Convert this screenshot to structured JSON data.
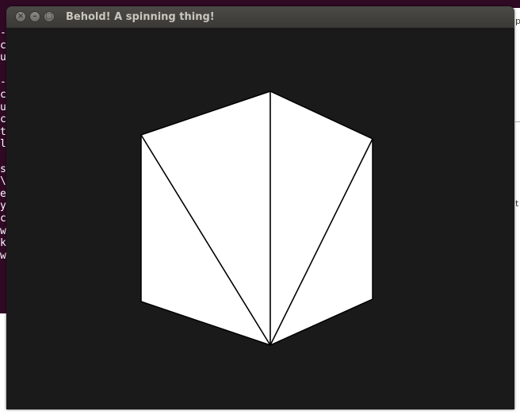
{
  "window": {
    "title": "Behold! A spinning thing!",
    "buttons": {
      "close": "×",
      "minimize": "–",
      "maximize": "□"
    }
  },
  "background": {
    "terminal_visible_chars": "-\nc\nu\n\n-\nc\nu\nc\nt\nl\n\ns\n\\\ne\ny\nc\nw\nk\nw",
    "right_window_fragments": [
      "p",
      "t"
    ]
  },
  "colors": {
    "canvas_bg": "#1a1a1a",
    "shape_fill": "#ffffff",
    "shape_stroke": "#000000",
    "terminal_bg": "#300a24"
  }
}
